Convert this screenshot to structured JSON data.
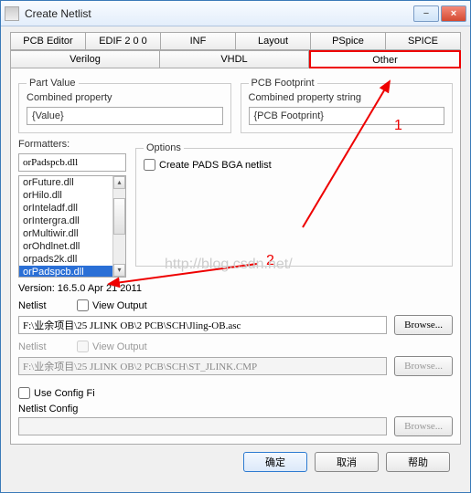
{
  "window": {
    "title": "Create Netlist"
  },
  "tabs_row1": [
    "PCB Editor",
    "EDIF 2 0 0",
    "INF",
    "Layout",
    "PSpice",
    "SPICE"
  ],
  "tabs_row2": [
    "Verilog",
    "VHDL",
    "Other"
  ],
  "partvalue": {
    "legend": "Part Value",
    "label": "Combined property",
    "value": "{Value}"
  },
  "pcbfoot": {
    "legend": "PCB Footprint",
    "label": "Combined property string",
    "value": "{PCB Footprint}"
  },
  "formatters": {
    "label": "Formatters:",
    "current": "orPadspcb.dll",
    "items": [
      "orFuture.dll",
      "orHilo.dll",
      "orInteladf.dll",
      "orIntergra.dll",
      "orMultiwir.dll",
      "orOhdlnet.dll",
      "orpads2k.dll",
      "orPadspcb.dll"
    ],
    "selected_index": 7
  },
  "options": {
    "legend": "Options",
    "create_pads": "Create PADS BGA netlist"
  },
  "version": "Version: 16.5.0  Apr 21 2011",
  "netlist1": {
    "label": "Netlist",
    "view": "View Output",
    "path": "F:\\业余项目\\25 JLINK OB\\2 PCB\\SCH\\Jling-OB.asc",
    "browse": "Browse..."
  },
  "netlist2": {
    "label": "Netlist",
    "view": "View Output",
    "path": "F:\\业余项目\\25 JLINK OB\\2 PCB\\SCH\\ST_JLINK.CMP",
    "browse": "Browse..."
  },
  "usecfg": {
    "label": "Use Config Fi",
    "cfg_label": "Netlist Config",
    "browse": "Browse..."
  },
  "buttons": {
    "ok": "确定",
    "cancel": "取消",
    "help": "帮助"
  },
  "annotations": {
    "one": "1",
    "two": "2",
    "watermark": "http://blog.csdn.net/"
  },
  "icons": {
    "minimize": "−",
    "close": "×",
    "up": "▴",
    "down": "▾"
  }
}
